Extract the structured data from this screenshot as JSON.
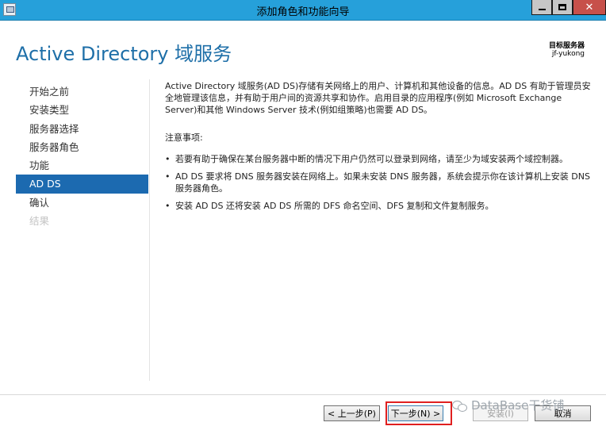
{
  "window": {
    "title": "添加角色和功能向导",
    "minimize_glyph": "",
    "close_glyph": "✕"
  },
  "header": {
    "title": "Active Directory 域服务",
    "target_server_label": "目标服务器",
    "target_server_value": "jf-yukong"
  },
  "nav": {
    "items": [
      {
        "label": "开始之前",
        "state": "normal"
      },
      {
        "label": "安装类型",
        "state": "normal"
      },
      {
        "label": "服务器选择",
        "state": "normal"
      },
      {
        "label": "服务器角色",
        "state": "normal"
      },
      {
        "label": "功能",
        "state": "normal"
      },
      {
        "label": "AD DS",
        "state": "active"
      },
      {
        "label": "确认",
        "state": "normal"
      },
      {
        "label": "结果",
        "state": "disabled"
      }
    ]
  },
  "content": {
    "intro": "Active Directory 域服务(AD DS)存储有关网络上的用户、计算机和其他设备的信息。AD DS 有助于管理员安全地管理该信息，并有助于用户间的资源共享和协作。启用目录的应用程序(例如 Microsoft Exchange Server)和其他 Windows Server 技术(例如组策略)也需要 AD DS。",
    "notes_title": "注意事项:",
    "notes": [
      "若要有助于确保在某台服务器中断的情况下用户仍然可以登录到网络，请至少为域安装两个域控制器。",
      "AD DS 要求将 DNS 服务器安装在网络上。如果未安装 DNS 服务器，系统会提示你在该计算机上安装 DNS 服务器角色。",
      "安装 AD DS 还将安装 AD DS 所需的 DFS 命名空间、DFS 复制和文件复制服务。"
    ]
  },
  "footer": {
    "prev_label": "< 上一步(P)",
    "next_label": "下一步(N) >",
    "install_label": "安装(I)",
    "cancel_label": "取消"
  },
  "watermark": {
    "text": "DataBase干货铺"
  },
  "colors": {
    "titlebar": "#26a0da",
    "header_title": "#1e6fa8",
    "nav_active": "#1c6ab0",
    "highlight": "#e02020"
  }
}
